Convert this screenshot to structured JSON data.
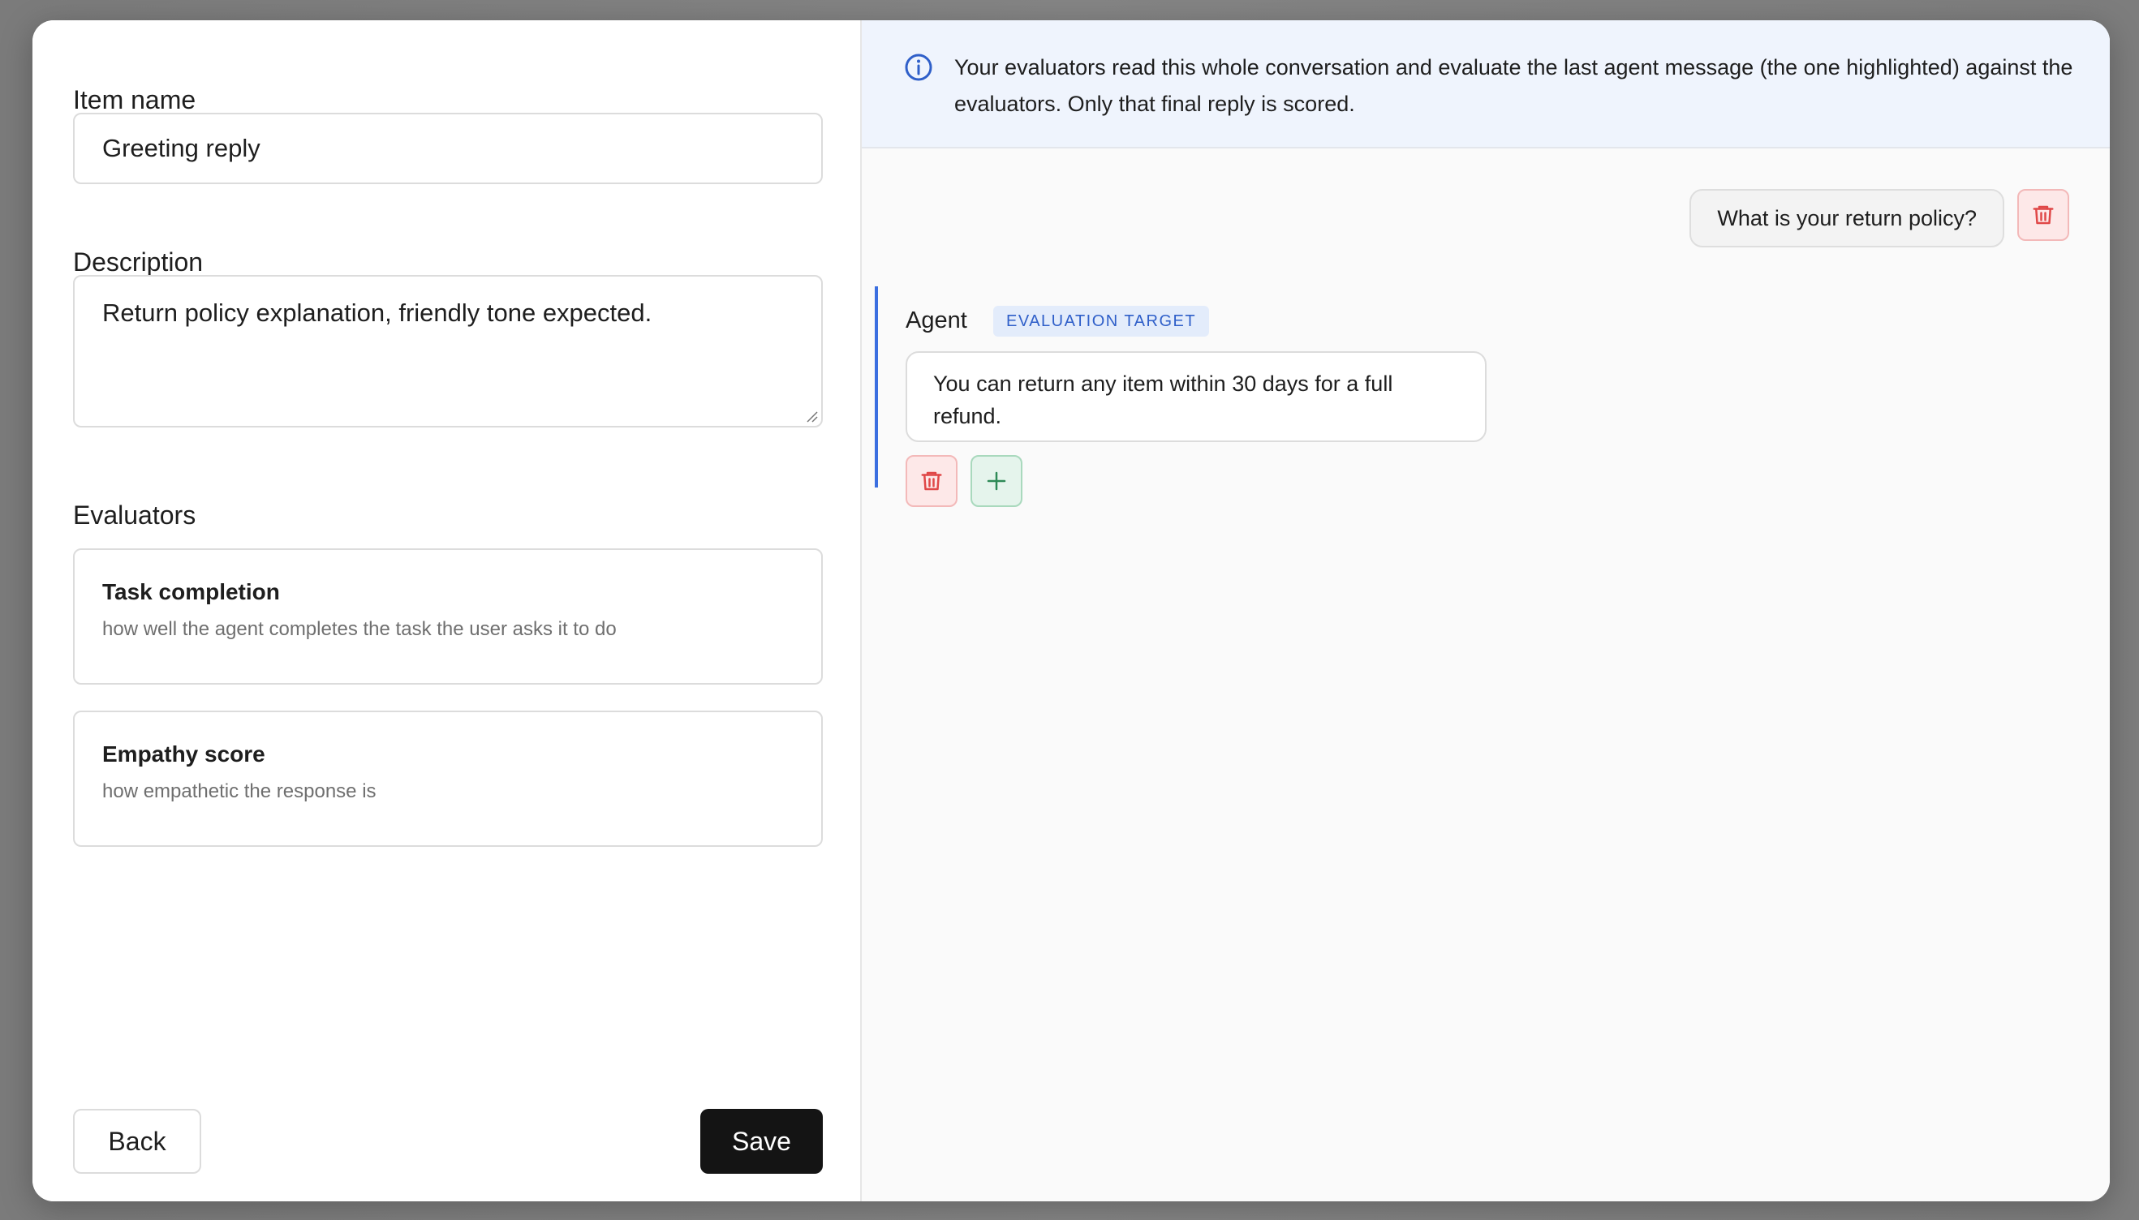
{
  "form": {
    "item_name_label": "Item name",
    "item_name_value": "Greeting reply",
    "description_label": "Description",
    "description_value": "Return policy explanation, friendly tone expected.",
    "evaluators_label": "Evaluators",
    "evaluators": [
      {
        "title": "Task completion",
        "description": "how well the agent completes the task the user asks it to do"
      },
      {
        "title": "Empathy score",
        "description": "how empathetic the response is"
      }
    ],
    "back_label": "Back",
    "save_label": "Save"
  },
  "conversation": {
    "info_text": "Your evaluators read this whole conversation and evaluate the last agent message (the one highlighted) against the evaluators. Only that final reply is scored.",
    "user_message": "What is your return policy?",
    "agent_name": "Agent",
    "target_badge": "EVALUATION TARGET",
    "agent_message": "You can return any item within 30 days for a full refund."
  },
  "colors": {
    "accent_blue": "#3b6fe0",
    "danger_red": "#e04848",
    "add_green": "#2e8a57",
    "save_button": "#141414"
  },
  "icons": {
    "info": "info-circle-icon",
    "trash": "trash-icon",
    "plus": "plus-icon"
  }
}
